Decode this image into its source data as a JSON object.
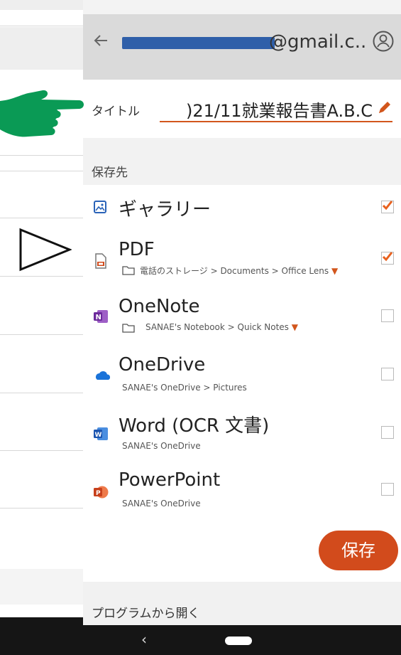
{
  "header": {
    "email_suffix": "@gmail.c..",
    "icons": {
      "back": "back-arrow-icon",
      "account": "account-circle-icon"
    }
  },
  "title_field": {
    "label": "タイトル",
    "value": ")21/11就業報告書A.B.C",
    "edit_icon": "pencil-icon"
  },
  "section_label": "保存先",
  "destinations": [
    {
      "name": "ギャラリー",
      "icon": "gallery-icon",
      "checked": true
    },
    {
      "name": "PDF",
      "icon": "pdf-file-icon",
      "sub": "電話のストレージ > Documents > Office Lens",
      "has_folder": true,
      "checked": true
    },
    {
      "name": "OneNote",
      "icon": "onenote-icon",
      "sub": "SANAE's Notebook > Quick Notes",
      "has_folder": true,
      "checked": false
    },
    {
      "name": "OneDrive",
      "icon": "onedrive-icon",
      "sub": "SANAE's OneDrive > Pictures",
      "checked": false
    },
    {
      "name": "Word (OCR 文書)",
      "icon": "word-icon",
      "sub": "SANAE's OneDrive",
      "checked": false
    },
    {
      "name": "PowerPoint",
      "icon": "powerpoint-icon",
      "sub": "SANAE's OneDrive",
      "checked": false
    }
  ],
  "save_button": "保存",
  "open_with_label": "プログラムから開く",
  "colors": {
    "accent": "#d24b1c",
    "checked": "#e8611e",
    "topbar": "#dadada",
    "email_mask": "#2f5fa9",
    "hand_arrow": "#0a9a55"
  },
  "annotations": {
    "green_hand": "pointing-hand-icon",
    "outline_arrow": "outline-arrow-icon"
  }
}
